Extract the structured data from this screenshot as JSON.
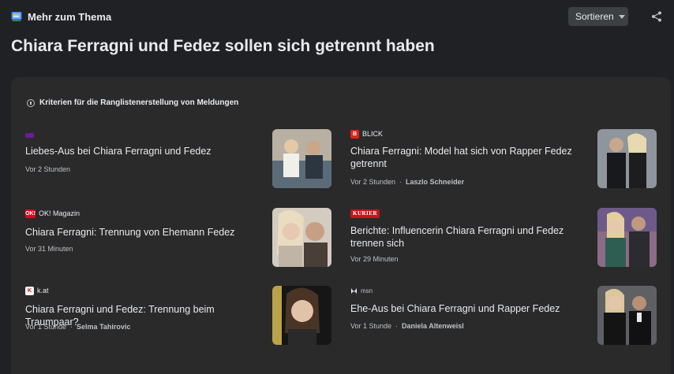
{
  "header": {
    "section_label": "Mehr zum Thema",
    "sort_label": "Sortieren",
    "icons": {
      "brand": "news-stack-icon",
      "share": "share-icon",
      "sort": "chevron-down-icon"
    }
  },
  "headline": "Chiara Ferragni und Fedez sollen sich getrennt haben",
  "criteria_label": "Kriterien für die Ranglistenerstellung von Meldungen",
  "articles": [
    {
      "source": "",
      "logo_text": "",
      "logo_color": "#6a1b9a",
      "title": "Liebes-Aus bei Chiara Ferragni und Fedez",
      "time": "Vor 2 Stunden",
      "author": "",
      "thumb_colors": [
        "#c9c2b5",
        "#3d4a5a"
      ]
    },
    {
      "source": "BLICK",
      "logo_text": "B",
      "logo_color": "#e2231a",
      "title": "Chiara Ferragni: Model hat sich von Rapper Fedez getrennt",
      "time": "Vor 2 Stunden",
      "author": "Laszlo Schneider",
      "thumb_colors": [
        "#9a9fa6",
        "#1c1c1f"
      ]
    },
    {
      "source": "OK! Magazin",
      "logo_text": "OK!",
      "logo_color": "#e3001b",
      "title": "Chiara Ferragni: Trennung von Ehemann Fedez",
      "time": "Vor 31 Minuten",
      "author": "",
      "thumb_colors": [
        "#d7cfc6",
        "#5b5048"
      ]
    },
    {
      "source": "",
      "logo_text": "KURIER",
      "logo_color": "#c4161c",
      "title": "Berichte: Influencerin Chiara Ferragni und Fedez trennen sich",
      "time": "Vor 29 Minuten",
      "author": "",
      "thumb_colors": [
        "#8e6a87",
        "#2f5a50"
      ]
    },
    {
      "source": "k.at",
      "logo_text": "K",
      "logo_color": "#f5f5f5",
      "title": "Chiara Ferragni und Fedez: Trennung beim Traumpaar?",
      "time": "Vor 1 Stunde",
      "author": "Selma Tahirovic",
      "thumb_colors": [
        "#b9a24a",
        "#1a1a1a"
      ]
    },
    {
      "source": "msn",
      "logo_text": "",
      "logo_color": "#202124",
      "title": "Ehe-Aus bei Chiara Ferragni und Rapper Fedez",
      "time": "Vor 1 Stunde",
      "author": "Daniela Altenweisl",
      "thumb_colors": [
        "#6d6d70",
        "#141416"
      ]
    }
  ]
}
